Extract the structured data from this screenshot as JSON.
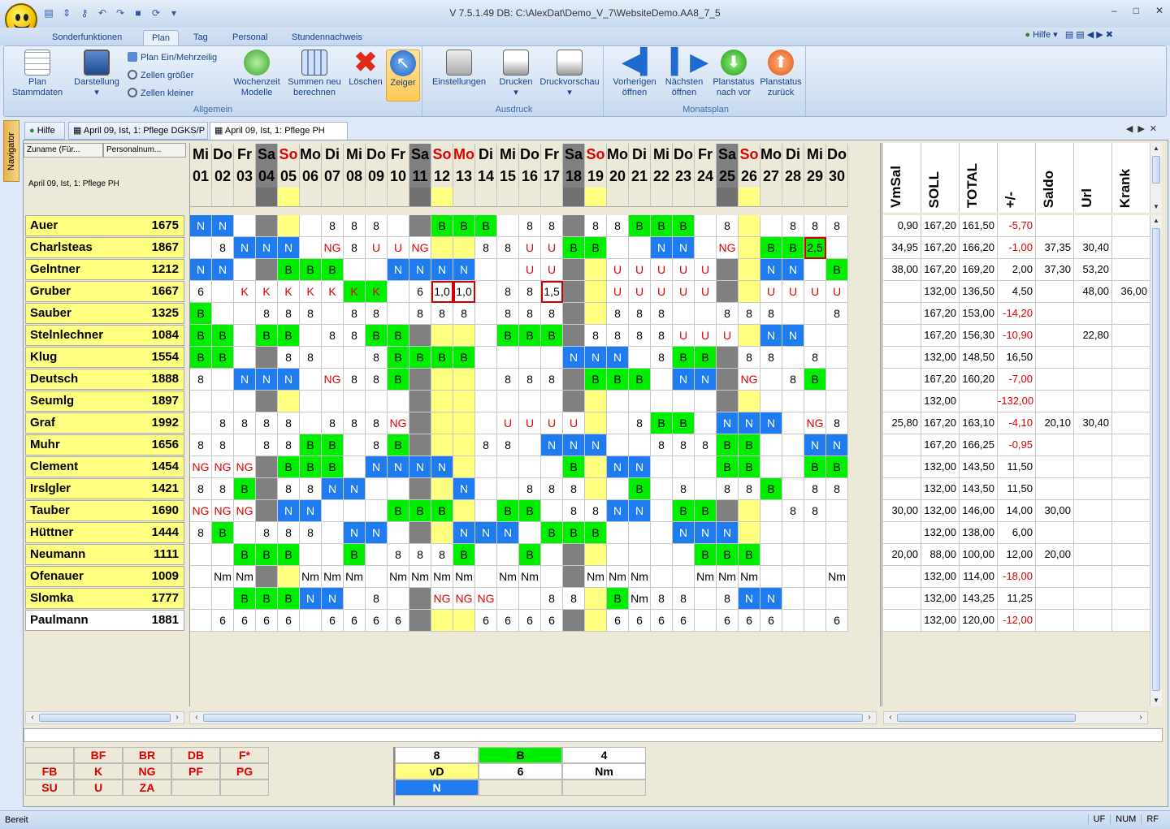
{
  "window": {
    "title": "V 7.5.1.49 DB: C:\\AlexDat\\Demo_V_7\\WebsiteDemo.AA8_7_5",
    "min": "–",
    "max": "□",
    "close": "✕"
  },
  "ribbon_tabs": [
    "Sonderfunktionen",
    "Plan",
    "Tag",
    "Personal",
    "Stundennachweis"
  ],
  "help_label": "Hilfe",
  "ribbon": {
    "allgemein": {
      "label": "Allgemein",
      "plan_stammdaten": "Plan\nStammdaten",
      "darstellung": "Darstellung",
      "plan_ein_mehrzeilig": "Plan Ein/Mehrzeilig",
      "zellen_groesser": "Zellen größer",
      "zellen_kleiner": "Zellen kleiner",
      "wochenzeit_modelle": "Wochenzeit\nModelle",
      "summen_neu": "Summen neu\nberechnen",
      "loeschen": "Löschen",
      "zeiger": "Zeiger"
    },
    "ausdruck": {
      "label": "Ausdruck",
      "einstellungen": "Einstellungen",
      "drucken": "Drucken",
      "druckvorschau": "Druckvorschau"
    },
    "monatsplan": {
      "label": "Monatsplan",
      "vorherigen": "Vorherigen\nöffnen",
      "naechsten": "Nächsten\nöffnen",
      "planstatus_vor": "Planstatus\nnach vor",
      "planstatus_zurueck": "Planstatus\nzurück"
    }
  },
  "navigator_label": "Navigator",
  "doc_tabs": [
    {
      "label": "Hilfe",
      "active": false
    },
    {
      "label": "April 09, Ist, 1: Pflege DGKS/P",
      "active": false
    },
    {
      "label": "April 09, Ist, 1: Pflege PH",
      "active": true
    }
  ],
  "left_header": {
    "col1": "Zuname (Für...",
    "col2": "Personalnum...",
    "info": "April 09, Ist, 1: Pflege PH"
  },
  "days": [
    {
      "wd": "Mi",
      "d": "01",
      "t": "w"
    },
    {
      "wd": "Do",
      "d": "02",
      "t": "w"
    },
    {
      "wd": "Fr",
      "d": "03",
      "t": "w"
    },
    {
      "wd": "Sa",
      "d": "04",
      "t": "sa"
    },
    {
      "wd": "So",
      "d": "05",
      "t": "so"
    },
    {
      "wd": "Mo",
      "d": "06",
      "t": "w"
    },
    {
      "wd": "Di",
      "d": "07",
      "t": "w"
    },
    {
      "wd": "Mi",
      "d": "08",
      "t": "w"
    },
    {
      "wd": "Do",
      "d": "09",
      "t": "w"
    },
    {
      "wd": "Fr",
      "d": "10",
      "t": "w"
    },
    {
      "wd": "Sa",
      "d": "11",
      "t": "sa"
    },
    {
      "wd": "So",
      "d": "12",
      "t": "so"
    },
    {
      "wd": "Mo",
      "d": "13",
      "t": "mo"
    },
    {
      "wd": "Di",
      "d": "14",
      "t": "w"
    },
    {
      "wd": "Mi",
      "d": "15",
      "t": "w"
    },
    {
      "wd": "Do",
      "d": "16",
      "t": "w"
    },
    {
      "wd": "Fr",
      "d": "17",
      "t": "w"
    },
    {
      "wd": "Sa",
      "d": "18",
      "t": "sa"
    },
    {
      "wd": "So",
      "d": "19",
      "t": "so"
    },
    {
      "wd": "Mo",
      "d": "20",
      "t": "w"
    },
    {
      "wd": "Di",
      "d": "21",
      "t": "w"
    },
    {
      "wd": "Mi",
      "d": "22",
      "t": "w"
    },
    {
      "wd": "Do",
      "d": "23",
      "t": "w"
    },
    {
      "wd": "Fr",
      "d": "24",
      "t": "w"
    },
    {
      "wd": "Sa",
      "d": "25",
      "t": "sa"
    },
    {
      "wd": "So",
      "d": "26",
      "t": "so"
    },
    {
      "wd": "Mo",
      "d": "27",
      "t": "w"
    },
    {
      "wd": "Di",
      "d": "28",
      "t": "w"
    },
    {
      "wd": "Mi",
      "d": "29",
      "t": "w"
    },
    {
      "wd": "Do",
      "d": "30",
      "t": "w"
    }
  ],
  "sum_headers": [
    "VmSal",
    "SOLL",
    "TOTAL",
    "+/-",
    "Saldo",
    "Url",
    "Krank"
  ],
  "employees": [
    {
      "name": "Auer",
      "nr": "1675",
      "cells": "N|N|||||8|8|8|||B|B|B||8|8||8|8|B|B|B||8|||8|8|8|2,5o",
      "sums": [
        "0,90",
        "167,20",
        "161,50",
        "-5,70",
        "",
        "",
        ""
      ]
    },
    {
      "name": "Charlsteas",
      "nr": "1867",
      "cells": "|8|N|N|N||NG|8|U|U|NG|||8|8|U|U|B|B|||N|N||NG||B|B|2,5o|",
      "sums": [
        "34,95",
        "167,20",
        "166,20",
        "-1,00",
        "37,35",
        "30,40",
        ""
      ]
    },
    {
      "name": "Gelntner",
      "nr": "1212",
      "cells": "N|N|||B|B|B|||N|N|N|N|||U|U|||U|U|U|U|U|||N|N||B",
      "sums": [
        "38,00",
        "167,20",
        "169,20",
        "2,00",
        "37,30",
        "53,20",
        ""
      ]
    },
    {
      "name": "Gruber",
      "nr": "1667",
      "cells": "6||K|K|K|K|K|K|K||6|1,0o|1,0o||8|8|1,5o|||U|U|U|U|U|||U|U|U|U",
      "sums": [
        "",
        "132,00",
        "136,50",
        "4,50",
        "",
        "48,00",
        "36,00"
      ]
    },
    {
      "name": "Sauber",
      "nr": "1325",
      "cells": "B|||8|8|8||8|8||8|8|8||8|8|8|||8|8|8|||8|8|8|||8",
      "sums": [
        "",
        "167,20",
        "153,00",
        "-14,20",
        "",
        "",
        ""
      ]
    },
    {
      "name": "Stelnlechner",
      "nr": "1084",
      "cells": "B|B||B|B||8|8|B|B|||||B|B|B||8|8|8|8|U|U|U||N|N||",
      "sums": [
        "",
        "167,20",
        "156,30",
        "-10,90",
        "",
        "22,80",
        ""
      ]
    },
    {
      "name": "Klug",
      "nr": "1554",
      "cells": "B|B|||8|8|||8|B|B|B|B|||||N|N|N||8|B|B||8|8||8",
      "sums": [
        "",
        "132,00",
        "148,50",
        "16,50",
        "",
        "",
        ""
      ]
    },
    {
      "name": "Deutsch",
      "nr": "1888",
      "cells": "8||N|N|N||NG|8|8|B|||||8|8|8||B|B|B||N|N||NG||8|B||8",
      "sums": [
        "",
        "167,20",
        "160,20",
        "-7,00",
        "",
        "",
        ""
      ]
    },
    {
      "name": "Seumlg",
      "nr": "1897",
      "cells": "|||||||||||||||||||||||||||||",
      "sums": [
        "",
        "132,00",
        "",
        "-132,00",
        "",
        "",
        ""
      ]
    },
    {
      "name": "Graf",
      "nr": "1992",
      "cells": "|8|8|8|8||8|8|8|NG|||||U|U|U|U|||8|B|B||N|N|N||NG|8|8",
      "sums": [
        "25,80",
        "167,20",
        "163,10",
        "-4,10",
        "20,10",
        "30,40",
        ""
      ]
    },
    {
      "name": "Muhr",
      "nr": "1656",
      "cells": "8|8||8|8|B|B||8|B||||8|8||N|N|N|||8|8|8|B|B|||N|N",
      "sums": [
        "",
        "167,20",
        "166,25",
        "-0,95",
        "",
        "",
        ""
      ]
    },
    {
      "name": "Clement",
      "nr": "1454",
      "cells": "NG|NG|NG||B|B|B||N|N|N|N||||||B||N|N||||B|B|||B|B",
      "sums": [
        "",
        "132,00",
        "143,50",
        "11,50",
        "",
        "",
        ""
      ]
    },
    {
      "name": "Irslgler",
      "nr": "1421",
      "cells": "8|8|B||8|8|N|N|||||N|||8|8|8|||B||8||8|8|B||8|8",
      "sums": [
        "",
        "132,00",
        "143,50",
        "11,50",
        "",
        "",
        ""
      ]
    },
    {
      "name": "Tauber",
      "nr": "1690",
      "cells": "NG|NG|NG||N|N||||B|B|B|||B|B||8|8|N|N||B|B||||8|8|",
      "sums": [
        "30,00",
        "132,00",
        "146,00",
        "14,00",
        "30,00",
        "",
        ""
      ]
    },
    {
      "name": "Hüttner",
      "nr": "1444",
      "cells": "8|B||8|8|8||N|N||||N|N|N||B|B|B||||N|N|N||||",
      "sums": [
        "",
        "132,00",
        "138,00",
        "6,00",
        "",
        "",
        ""
      ]
    },
    {
      "name": "Neumann",
      "nr": "1111",
      "cells": "||B|B|B|||B||8|8|8|B|||B||||||||B|B|B||||",
      "sums": [
        "20,00",
        "88,00",
        "100,00",
        "12,00",
        "20,00",
        "",
        ""
      ]
    },
    {
      "name": "Ofenauer",
      "nr": "1009",
      "cells": "|Nm|Nm|||Nm|Nm|Nm||Nm|Nm|Nm|Nm||Nm|Nm|||Nm|Nm|Nm|||Nm|Nm|Nm||||Nm",
      "sums": [
        "",
        "132,00",
        "114,00",
        "-18,00",
        "",
        "",
        ""
      ]
    },
    {
      "name": "Slomka",
      "nr": "1777",
      "cells": "||B|B|B|N|N||8|||NG|NG|NG|||8|8||B|Nm|8|8||8|N|N|",
      "sums": [
        "",
        "132,00",
        "143,25",
        "11,25",
        "",
        "",
        ""
      ]
    },
    {
      "name": "Paulmann",
      "nr": "1881",
      "cells": "|6|6|6|6||6|6|6|6||||6|6|6|6|||6|6|6|6||6|6|6|||6",
      "sums": [
        "",
        "132,00",
        "120,00",
        "-12,00",
        "",
        "",
        ""
      ]
    }
  ],
  "legend_codes": [
    [
      "",
      "BF",
      "BR",
      "DB",
      "F*"
    ],
    [
      "FB",
      "K",
      "NG",
      "PF",
      "PG"
    ],
    [
      "SU",
      "U",
      "ZA",
      "",
      ""
    ]
  ],
  "legend_shifts": [
    [
      {
        "t": "8",
        "c": "#ffffff"
      },
      {
        "t": "B",
        "c": "#00ee00"
      },
      {
        "t": "4",
        "c": "#ffffff"
      }
    ],
    [
      {
        "t": "vD",
        "c": "#ffff80"
      },
      {
        "t": "6",
        "c": "#ffffff"
      },
      {
        "t": "Nm",
        "c": "#ffffff"
      }
    ],
    [
      {
        "t": "N",
        "c": "#1e7cf0"
      },
      {
        "t": "",
        "c": "#ece9d8"
      },
      {
        "t": "",
        "c": "#ece9d8"
      }
    ]
  ],
  "status": {
    "left": "Bereit",
    "right": [
      "UF",
      "NUM",
      "RF"
    ]
  }
}
